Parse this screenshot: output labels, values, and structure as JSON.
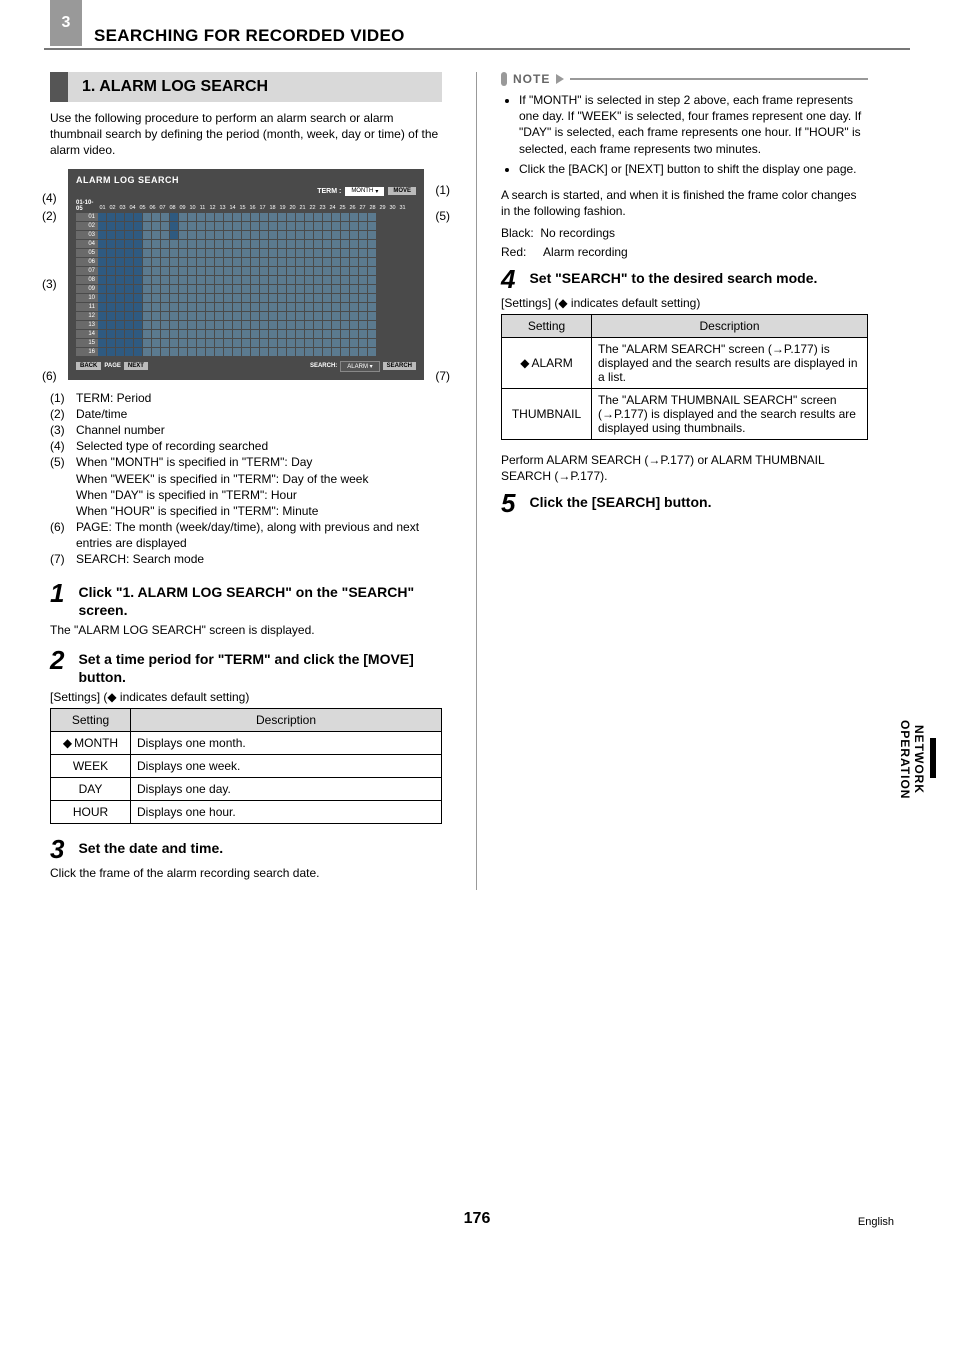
{
  "chapter": "3",
  "chapter_title": "SEARCHING FOR RECORDED VIDEO",
  "section_number": "1.",
  "section_title": "ALARM LOG SEARCH",
  "intro": "Use the following procedure to perform an alarm search or alarm thumbnail search by defining the period (month, week, day or time) of the alarm video.",
  "diagram": {
    "title": "ALARM LOG SEARCH",
    "term_label": "TERM :",
    "term_value": "MONTH",
    "move_btn": "MOVE",
    "date_label": "01-10-05",
    "days": [
      "01",
      "02",
      "03",
      "04",
      "05",
      "06",
      "07",
      "08",
      "09",
      "10",
      "11",
      "12",
      "13",
      "14",
      "15",
      "16",
      "17",
      "18",
      "19",
      "20",
      "21",
      "22",
      "23",
      "24",
      "25",
      "26",
      "27",
      "28",
      "29",
      "30",
      "31"
    ],
    "channels": [
      "01",
      "02",
      "03",
      "04",
      "05",
      "06",
      "07",
      "08",
      "09",
      "10",
      "11",
      "12",
      "13",
      "14",
      "15",
      "16"
    ],
    "back_btn": "BACK",
    "page_label": "PAGE",
    "next_btn": "NEXT",
    "search_label": "SEARCH:",
    "search_value": "ALARM",
    "search_btn": "SEARCH"
  },
  "callouts": {
    "c1": "(1)",
    "c2": "(2)",
    "c3": "(3)",
    "c4": "(4)",
    "c5": "(5)",
    "c6": "(6)",
    "c7": "(7)"
  },
  "legend": {
    "1": {
      "n": "(1)",
      "t": "TERM: Period"
    },
    "2": {
      "n": "(2)",
      "t": "Date/time"
    },
    "3": {
      "n": "(3)",
      "t": "Channel number"
    },
    "4": {
      "n": "(4)",
      "t": "Selected type of recording searched"
    },
    "5": {
      "n": "(5)",
      "t": "When \"MONTH\" is specified in \"TERM\": Day\nWhen \"WEEK\" is specified in \"TERM\": Day of the week\nWhen \"DAY\" is specified in \"TERM\": Hour\nWhen \"HOUR\" is specified in \"TERM\": Minute"
    },
    "6": {
      "n": "(6)",
      "t": "PAGE: The month (week/day/time), along with previous and next entries are displayed"
    },
    "7": {
      "n": "(7)",
      "t": "SEARCH: Search mode"
    }
  },
  "steps": {
    "1": {
      "num": "1",
      "title": "Click \"1. ALARM LOG SEARCH\" on the \"SEARCH\" screen.",
      "desc": "The \"ALARM LOG SEARCH\" screen is displayed."
    },
    "2": {
      "num": "2",
      "title": "Set a time period for \"TERM\" and click the [MOVE] button."
    },
    "3": {
      "num": "3",
      "title": "Set the date and time.",
      "desc": "Click the frame of the alarm recording search date."
    },
    "4": {
      "num": "4",
      "title": "Set \"SEARCH\" to the desired search mode."
    },
    "5": {
      "num": "5",
      "title": "Click the [SEARCH] button."
    }
  },
  "settings_note": "[Settings] (◆ indicates default setting)",
  "term_table": {
    "h1": "Setting",
    "h2": "Description",
    "rows": [
      {
        "s": "MONTH",
        "d": "Displays one month.",
        "def": true
      },
      {
        "s": "WEEK",
        "d": "Displays one week.",
        "def": false
      },
      {
        "s": "DAY",
        "d": "Displays one day.",
        "def": false
      },
      {
        "s": "HOUR",
        "d": "Displays one hour.",
        "def": false
      }
    ]
  },
  "note_label": "NOTE",
  "note_bullets": {
    "1": "If \"MONTH\" is selected in step 2 above, each frame represents one day. If \"WEEK\" is selected, four frames represent one day. If \"DAY\" is selected, each frame represents one hour. If \"HOUR\" is selected, each frame represents two minutes.",
    "2": "Click the [BACK] or [NEXT] button to shift the display one page."
  },
  "search_started": "A search is started, and when it is finished the frame color changes in the following fashion.",
  "black_label": "Black:",
  "black_val": "No recordings",
  "red_label": "Red:",
  "red_val": "Alarm recording",
  "search_table": {
    "h1": "Setting",
    "h2": "Description",
    "rows": [
      {
        "s": "ALARM",
        "d": "The \"ALARM SEARCH\" screen (→P.177) is displayed and the search results are displayed in a list.",
        "def": true
      },
      {
        "s": "THUMBNAIL",
        "d": "The \"ALARM THUMBNAIL SEARCH\" screen (→P.177) is displayed and the search results are displayed using thumbnails.",
        "def": false
      }
    ]
  },
  "perform_text": "Perform ALARM SEARCH (→P.177) or ALARM THUMBNAIL SEARCH (→P.177).",
  "side_tab": "NETWORK\nOPERATION",
  "page_number": "176",
  "language": "English"
}
